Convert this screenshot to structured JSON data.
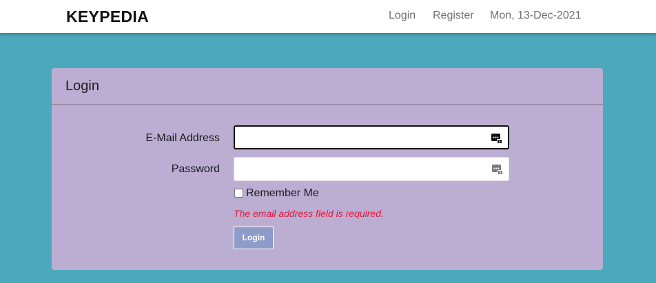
{
  "navbar": {
    "brand": "KEYPEDIA",
    "links": {
      "login": "Login",
      "register": "Register"
    },
    "date": "Mon, 13-Dec-2021"
  },
  "card": {
    "title": "Login",
    "fields": {
      "email": {
        "label": "E-Mail Address",
        "value": "",
        "icon": "password-manager-icon"
      },
      "password": {
        "label": "Password",
        "value": "",
        "icon": "password-manager-icon"
      }
    },
    "remember": {
      "label": "Remember Me",
      "checked": false
    },
    "error": "The email address field is required.",
    "submit_label": "Login"
  },
  "colors": {
    "page_background": "#4ba8bd",
    "card_background": "#bbaed2",
    "button_background": "#8f9bc9",
    "error_text": "#e3173d"
  }
}
